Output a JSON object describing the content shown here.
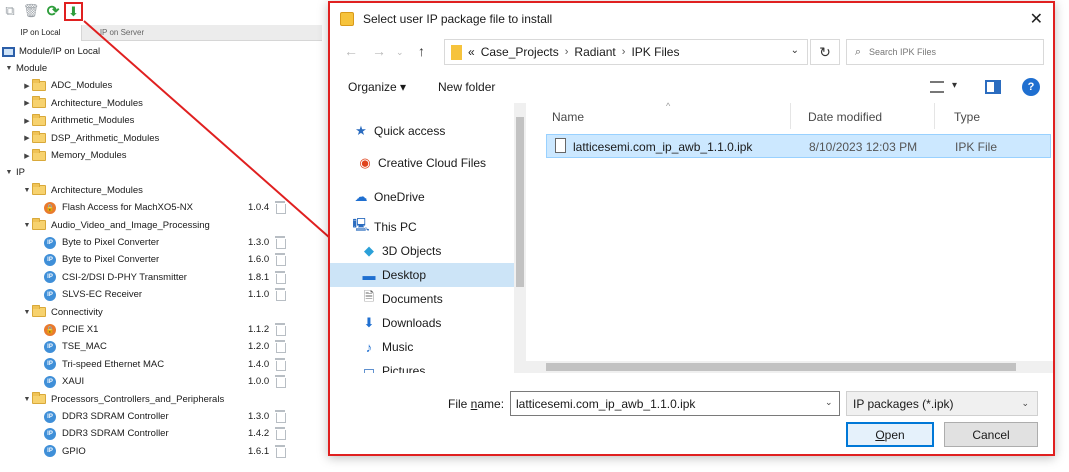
{
  "left_panel": {
    "tabs": [
      "IP on Local",
      "IP on Server"
    ],
    "root": "Module/IP on Local",
    "tree": [
      {
        "type": "group",
        "label": "Module",
        "depth": 0,
        "open": true
      },
      {
        "type": "folder",
        "label": "ADC_Modules",
        "depth": 1,
        "open": false
      },
      {
        "type": "folder",
        "label": "Architecture_Modules",
        "depth": 1,
        "open": false
      },
      {
        "type": "folder",
        "label": "Arithmetic_Modules",
        "depth": 1,
        "open": false
      },
      {
        "type": "folder",
        "label": "DSP_Arithmetic_Modules",
        "depth": 1,
        "open": false
      },
      {
        "type": "folder",
        "label": "Memory_Modules",
        "depth": 1,
        "open": false
      },
      {
        "type": "group",
        "label": "IP",
        "depth": 0,
        "open": true
      },
      {
        "type": "folder",
        "label": "Architecture_Modules",
        "depth": 1,
        "open": true
      },
      {
        "type": "locked",
        "label": "Flash Access for MachXO5-NX",
        "depth": 2,
        "version": "1.0.4"
      },
      {
        "type": "folder",
        "label": "Audio_Video_and_Image_Processing",
        "depth": 1,
        "open": true
      },
      {
        "type": "ip",
        "label": "Byte to Pixel Converter",
        "depth": 2,
        "version": "1.3.0"
      },
      {
        "type": "ip",
        "label": "Byte to Pixel Converter",
        "depth": 2,
        "version": "1.6.0"
      },
      {
        "type": "ip",
        "label": "CSI-2/DSI D-PHY Transmitter",
        "depth": 2,
        "version": "1.8.1"
      },
      {
        "type": "ip",
        "label": "SLVS-EC Receiver",
        "depth": 2,
        "version": "1.1.0"
      },
      {
        "type": "folder",
        "label": "Connectivity",
        "depth": 1,
        "open": true
      },
      {
        "type": "locked",
        "label": "PCIE X1",
        "depth": 2,
        "version": "1.1.2"
      },
      {
        "type": "ip",
        "label": "TSE_MAC",
        "depth": 2,
        "version": "1.2.0"
      },
      {
        "type": "ip",
        "label": "Tri-speed Ethernet MAC",
        "depth": 2,
        "version": "1.4.0"
      },
      {
        "type": "ip",
        "label": "XAUI",
        "depth": 2,
        "version": "1.0.0"
      },
      {
        "type": "folder",
        "label": "Processors_Controllers_and_Peripherals",
        "depth": 1,
        "open": true
      },
      {
        "type": "ip",
        "label": "DDR3 SDRAM Controller",
        "depth": 2,
        "version": "1.3.0"
      },
      {
        "type": "ip",
        "label": "DDR3 SDRAM Controller",
        "depth": 2,
        "version": "1.4.2"
      },
      {
        "type": "ip",
        "label": "GPIO",
        "depth": 2,
        "version": "1.6.1"
      }
    ]
  },
  "dialog": {
    "title": "Select user IP package file to install",
    "close_glyph": "✕",
    "address": {
      "prefix": "«",
      "parts": [
        "Case_Projects",
        "Radiant",
        "IPK Files"
      ]
    },
    "search_placeholder": "Search IPK Files",
    "organize": "Organize ▾",
    "new_folder": "New folder",
    "nav_items": [
      {
        "label": "Quick access",
        "icon": "star-icon"
      },
      {
        "label": "Creative Cloud Files",
        "icon": "creative-cloud-icon"
      },
      {
        "label": "OneDrive",
        "icon": "cloud-icon"
      },
      {
        "label": "This PC",
        "icon": "computer-icon"
      },
      {
        "label": "3D Objects",
        "icon": "cube-icon"
      },
      {
        "label": "Desktop",
        "icon": "desktop-icon"
      },
      {
        "label": "Documents",
        "icon": "document-icon"
      },
      {
        "label": "Downloads",
        "icon": "download-icon"
      },
      {
        "label": "Music",
        "icon": "music-icon"
      },
      {
        "label": "Pictures",
        "icon": "picture-icon"
      }
    ],
    "columns": {
      "name": "Name",
      "date": "Date modified",
      "type": "Type"
    },
    "files": [
      {
        "name": "latticesemi.com_ip_awb_1.1.0.ipk",
        "date": "8/10/2023 12:03 PM",
        "type": "IPK File"
      }
    ],
    "file_name_label_pre": "File ",
    "file_name_label_key": "n",
    "file_name_label_post": "ame:",
    "file_name_value": "latticesemi.com_ip_awb_1.1.0.ipk",
    "file_type": "IP packages (*.ipk)",
    "open_key": "O",
    "open_rest": "pen",
    "cancel": "Cancel"
  },
  "colors": {
    "callout": "#e02020",
    "selection": "#cce8ff",
    "accent": "#0078d7"
  }
}
